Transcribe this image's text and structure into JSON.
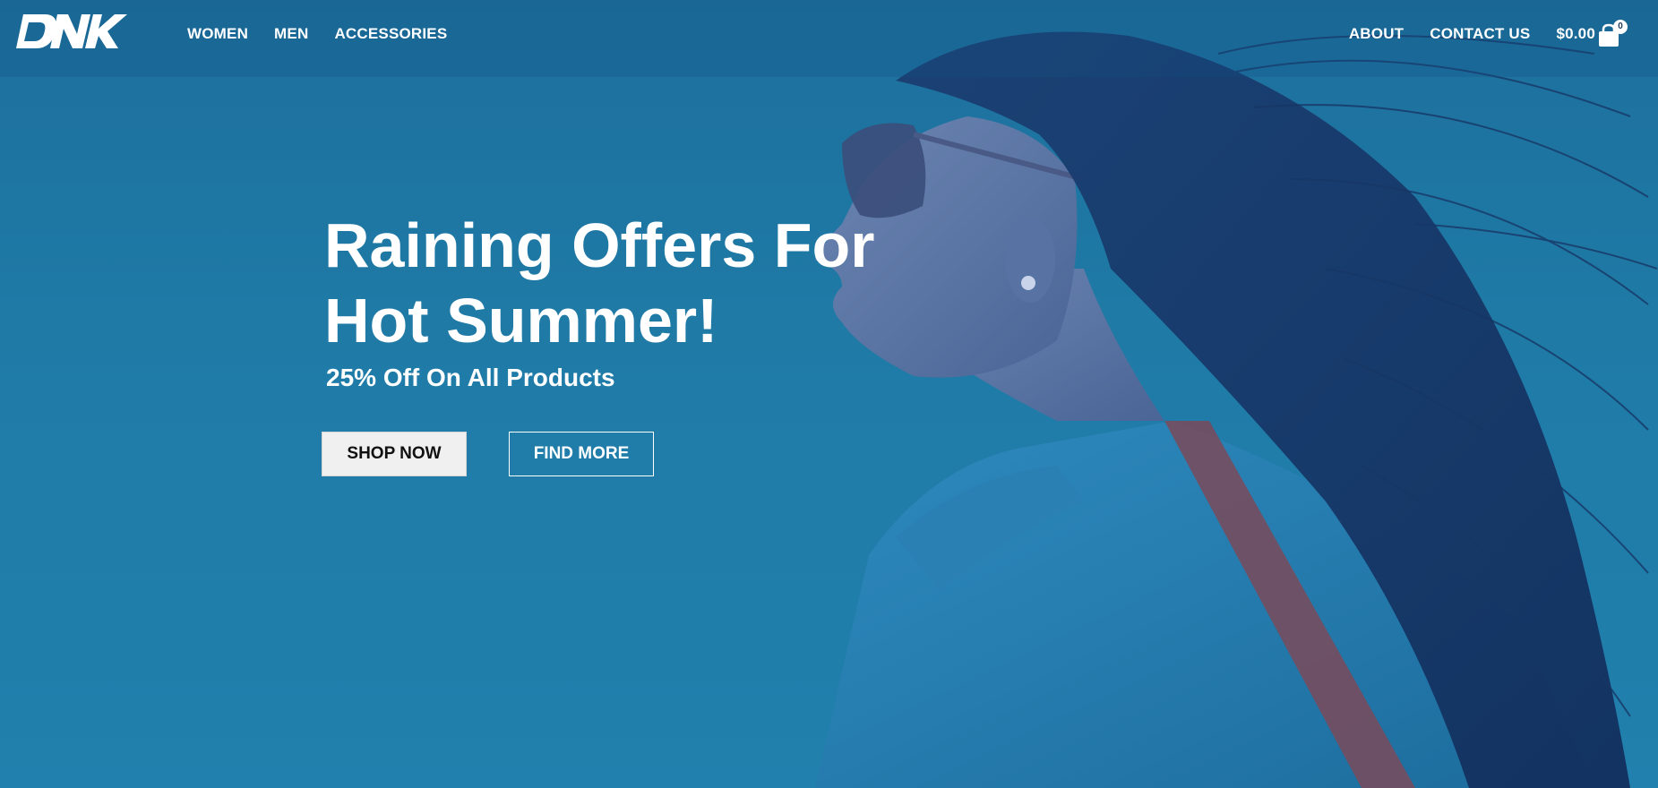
{
  "brand": {
    "logo_text": "DNK"
  },
  "nav": {
    "left": [
      "WOMEN",
      "MEN",
      "ACCESSORIES"
    ],
    "right": [
      "ABOUT",
      "CONTACT US",
      "$0.00"
    ]
  },
  "cart": {
    "count": "0",
    "icon": "shopping-bag-icon"
  },
  "hero": {
    "title_line1": "Raining Offers For",
    "title_line2": "Hot Summer!",
    "subtitle": "25% Off On All Products",
    "primary_button": "SHOP NOW",
    "secondary_button": "FIND MORE"
  },
  "colors": {
    "background": "#1f7aa6",
    "text": "#ffffff",
    "primary_button_bg": "#f0f0f0"
  }
}
